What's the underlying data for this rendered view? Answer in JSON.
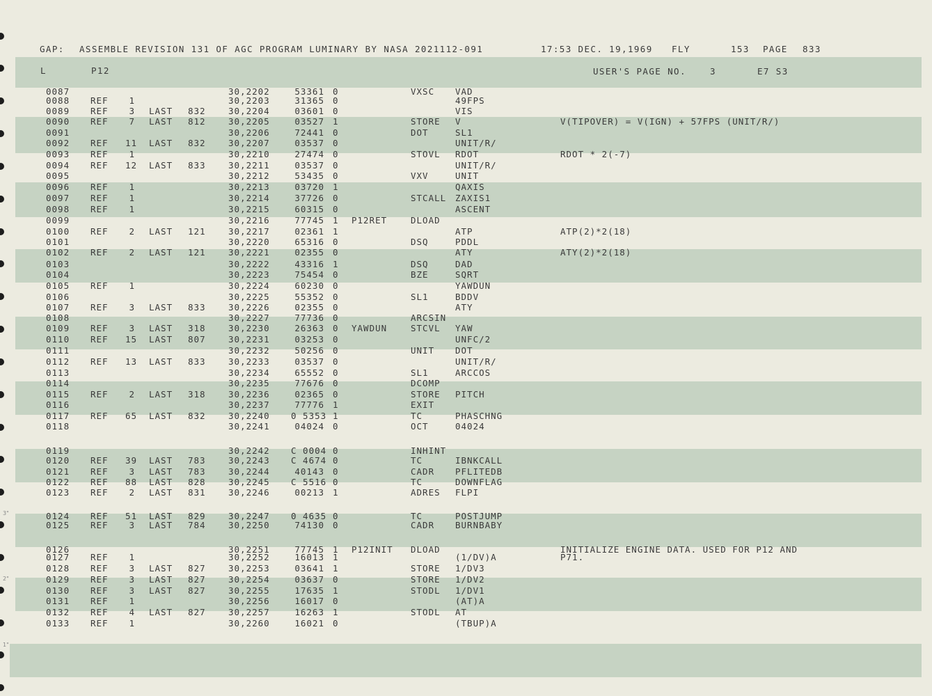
{
  "header": {
    "line1": {
      "gap": "GAP:",
      "title": "ASSEMBLE REVISION 131 OF AGC PROGRAM LUMINARY BY NASA 2021112-091",
      "time": "17:53 DEC. 19,1969",
      "fly": "FLY",
      "num": "153",
      "page_label": "PAGE",
      "page": "833"
    },
    "line2": {
      "l": "L",
      "prog": "P12",
      "users_page": "USER'S PAGE NO.",
      "users_page_num": "3",
      "e7s3": "E7 S3"
    }
  },
  "rows": [
    {
      "n": "0087",
      "ref": "",
      "rn": "",
      "last": "",
      "lp": "",
      "addr": "30,2202",
      "code": "53361",
      "par": "0",
      "label": "",
      "op": "VXSC",
      "operand": "VAD",
      "comment": ""
    },
    {
      "n": "0088",
      "ref": "REF",
      "rn": "1",
      "last": "",
      "lp": "",
      "addr": "30,2203",
      "code": "31365",
      "par": "0",
      "label": "",
      "op": "",
      "operand": "49FPS",
      "comment": ""
    },
    {
      "n": "0089",
      "ref": "REF",
      "rn": "3",
      "last": "LAST",
      "lp": "832",
      "addr": "30,2204",
      "code": "03601",
      "par": "0",
      "label": "",
      "op": "",
      "operand": "VIS",
      "comment": ""
    },
    {
      "n": "0090",
      "ref": "REF",
      "rn": "7",
      "last": "LAST",
      "lp": "812",
      "addr": "30,2205",
      "code": "03527",
      "par": "1",
      "label": "",
      "op": "STORE",
      "operand": "V",
      "comment": "V(TIPOVER) = V(IGN) + 57FPS (UNIT/R/)"
    },
    {
      "n": "0091",
      "ref": "",
      "rn": "",
      "last": "",
      "lp": "",
      "addr": "30,2206",
      "code": "72441",
      "par": "0",
      "label": "",
      "op": "DOT",
      "operand": "SL1",
      "comment": ""
    },
    {
      "n": "0092",
      "ref": "REF",
      "rn": "11",
      "last": "LAST",
      "lp": "832",
      "addr": "30,2207",
      "code": "03537",
      "par": "0",
      "label": "",
      "op": "",
      "operand": "UNIT/R/",
      "comment": ""
    },
    {
      "n": "0093",
      "ref": "REF",
      "rn": "1",
      "last": "",
      "lp": "",
      "addr": "30,2210",
      "code": "27474",
      "par": "0",
      "label": "",
      "op": "STOVL",
      "operand": "RDOT",
      "comment": "RDOT * 2(-7)"
    },
    {
      "n": "0094",
      "ref": "REF",
      "rn": "12",
      "last": "LAST",
      "lp": "833",
      "addr": "30,2211",
      "code": "03537",
      "par": "0",
      "label": "",
      "op": "",
      "operand": "UNIT/R/",
      "comment": ""
    },
    {
      "n": "0095",
      "ref": "",
      "rn": "",
      "last": "",
      "lp": "",
      "addr": "30,2212",
      "code": "53435",
      "par": "0",
      "label": "",
      "op": "VXV",
      "operand": "UNIT",
      "comment": ""
    },
    {
      "n": "0096",
      "ref": "REF",
      "rn": "1",
      "last": "",
      "lp": "",
      "addr": "30,2213",
      "code": "03720",
      "par": "1",
      "label": "",
      "op": "",
      "operand": "QAXIS",
      "comment": ""
    },
    {
      "n": "0097",
      "ref": "REF",
      "rn": "1",
      "last": "",
      "lp": "",
      "addr": "30,2214",
      "code": "37726",
      "par": "0",
      "label": "",
      "op": "STCALL",
      "operand": "ZAXIS1",
      "comment": ""
    },
    {
      "n": "0098",
      "ref": "REF",
      "rn": "1",
      "last": "",
      "lp": "",
      "addr": "30,2215",
      "code": "60315",
      "par": "0",
      "label": "",
      "op": "",
      "operand": "ASCENT",
      "comment": ""
    },
    {
      "n": "0099",
      "ref": "",
      "rn": "",
      "last": "",
      "lp": "",
      "addr": "30,2216",
      "code": "77745",
      "par": "1",
      "label": "P12RET",
      "op": "DLOAD",
      "operand": "",
      "comment": ""
    },
    {
      "n": "0100",
      "ref": "REF",
      "rn": "2",
      "last": "LAST",
      "lp": "121",
      "addr": "30,2217",
      "code": "02361",
      "par": "1",
      "label": "",
      "op": "",
      "operand": "ATP",
      "comment": "ATP(2)*2(18)"
    },
    {
      "n": "0101",
      "ref": "",
      "rn": "",
      "last": "",
      "lp": "",
      "addr": "30,2220",
      "code": "65316",
      "par": "0",
      "label": "",
      "op": "DSQ",
      "operand": "PDDL",
      "comment": ""
    },
    {
      "n": "0102",
      "ref": "REF",
      "rn": "2",
      "last": "LAST",
      "lp": "121",
      "addr": "30,2221",
      "code": "02355",
      "par": "0",
      "label": "",
      "op": "",
      "operand": "ATY",
      "comment": "ATY(2)*2(18)"
    },
    {
      "n": "0103",
      "ref": "",
      "rn": "",
      "last": "",
      "lp": "",
      "addr": "30,2222",
      "code": "43316",
      "par": "1",
      "label": "",
      "op": "DSQ",
      "operand": "DAD",
      "comment": ""
    },
    {
      "n": "0104",
      "ref": "",
      "rn": "",
      "last": "",
      "lp": "",
      "addr": "30,2223",
      "code": "75454",
      "par": "0",
      "label": "",
      "op": "BZE",
      "operand": "SQRT",
      "comment": ""
    },
    {
      "n": "0105",
      "ref": "REF",
      "rn": "1",
      "last": "",
      "lp": "",
      "addr": "30,2224",
      "code": "60230",
      "par": "0",
      "label": "",
      "op": "",
      "operand": "YAWDUN",
      "comment": ""
    },
    {
      "n": "0106",
      "ref": "",
      "rn": "",
      "last": "",
      "lp": "",
      "addr": "30,2225",
      "code": "55352",
      "par": "0",
      "label": "",
      "op": "SL1",
      "operand": "BDDV",
      "comment": ""
    },
    {
      "n": "0107",
      "ref": "REF",
      "rn": "3",
      "last": "LAST",
      "lp": "833",
      "addr": "30,2226",
      "code": "02355",
      "par": "0",
      "label": "",
      "op": "",
      "operand": "ATY",
      "comment": ""
    },
    {
      "n": "0108",
      "ref": "",
      "rn": "",
      "last": "",
      "lp": "",
      "addr": "30,2227",
      "code": "77736",
      "par": "0",
      "label": "",
      "op": "ARCSIN",
      "operand": "",
      "comment": ""
    },
    {
      "n": "0109",
      "ref": "REF",
      "rn": "3",
      "last": "LAST",
      "lp": "318",
      "addr": "30,2230",
      "code": "26363",
      "par": "0",
      "label": "YAWDUN",
      "op": "STCVL",
      "operand": "YAW",
      "comment": ""
    },
    {
      "n": "0110",
      "ref": "REF",
      "rn": "15",
      "last": "LAST",
      "lp": "807",
      "addr": "30,2231",
      "code": "03253",
      "par": "0",
      "label": "",
      "op": "",
      "operand": "UNFC/2",
      "comment": ""
    },
    {
      "n": "0111",
      "ref": "",
      "rn": "",
      "last": "",
      "lp": "",
      "addr": "30,2232",
      "code": "50256",
      "par": "0",
      "label": "",
      "op": "UNIT",
      "operand": "DOT",
      "comment": ""
    },
    {
      "n": "0112",
      "ref": "REF",
      "rn": "13",
      "last": "LAST",
      "lp": "833",
      "addr": "30,2233",
      "code": "03537",
      "par": "0",
      "label": "",
      "op": "",
      "operand": "UNIT/R/",
      "comment": ""
    },
    {
      "n": "0113",
      "ref": "",
      "rn": "",
      "last": "",
      "lp": "",
      "addr": "30,2234",
      "code": "65552",
      "par": "0",
      "label": "",
      "op": "SL1",
      "operand": "ARCCOS",
      "comment": ""
    },
    {
      "n": "0114",
      "ref": "",
      "rn": "",
      "last": "",
      "lp": "",
      "addr": "30,2235",
      "code": "77676",
      "par": "0",
      "label": "",
      "op": "DCOMP",
      "operand": "",
      "comment": ""
    },
    {
      "n": "0115",
      "ref": "REF",
      "rn": "2",
      "last": "LAST",
      "lp": "318",
      "addr": "30,2236",
      "code": "02365",
      "par": "0",
      "label": "",
      "op": "STORE",
      "operand": "PITCH",
      "comment": ""
    },
    {
      "n": "0116",
      "ref": "",
      "rn": "",
      "last": "",
      "lp": "",
      "addr": "30,2237",
      "code": "77776",
      "par": "1",
      "label": "",
      "op": "EXIT",
      "operand": "",
      "comment": ""
    },
    {
      "n": "0117",
      "ref": "REF",
      "rn": "65",
      "last": "LAST",
      "lp": "832",
      "addr": "30,2240",
      "code": "0 5353",
      "par": "1",
      "label": "",
      "op": "TC",
      "operand": "PHASCHNG",
      "comment": ""
    },
    {
      "n": "0118",
      "ref": "",
      "rn": "",
      "last": "",
      "lp": "",
      "addr": "30,2241",
      "code": "04024",
      "par": "0",
      "label": "",
      "op": "OCT",
      "operand": "04024",
      "comment": ""
    },
    {
      "n": "0119",
      "ref": "",
      "rn": "",
      "last": "",
      "lp": "",
      "addr": "30,2242",
      "code": "C 0004",
      "par": "0",
      "label": "",
      "op": "INHINT",
      "operand": "",
      "comment": ""
    },
    {
      "n": "0120",
      "ref": "REF",
      "rn": "39",
      "last": "LAST",
      "lp": "783",
      "addr": "30,2243",
      "code": "C 4674",
      "par": "0",
      "label": "",
      "op": "TC",
      "operand": "IBNKCALL",
      "comment": ""
    },
    {
      "n": "0121",
      "ref": "REF",
      "rn": "3",
      "last": "LAST",
      "lp": "783",
      "addr": "30,2244",
      "code": "40143",
      "par": "0",
      "label": "",
      "op": "CADR",
      "operand": "PFLITEDB",
      "comment": ""
    },
    {
      "n": "0122",
      "ref": "REF",
      "rn": "88",
      "last": "LAST",
      "lp": "828",
      "addr": "30,2245",
      "code": "C 5516",
      "par": "0",
      "label": "",
      "op": "TC",
      "operand": "DOWNFLAG",
      "comment": ""
    },
    {
      "n": "0123",
      "ref": "REF",
      "rn": "2",
      "last": "LAST",
      "lp": "831",
      "addr": "30,2246",
      "code": "00213",
      "par": "1",
      "label": "",
      "op": "ADRES",
      "operand": "FLPI",
      "comment": ""
    },
    {
      "n": "0124",
      "ref": "REF",
      "rn": "51",
      "last": "LAST",
      "lp": "829",
      "addr": "30,2247",
      "code": "0 4635",
      "par": "0",
      "label": "",
      "op": "TC",
      "operand": "POSTJUMP",
      "comment": ""
    },
    {
      "n": "0125",
      "ref": "REF",
      "rn": "3",
      "last": "LAST",
      "lp": "784",
      "addr": "30,2250",
      "code": "74130",
      "par": "0",
      "label": "",
      "op": "CADR",
      "operand": "BURNBABY",
      "comment": ""
    },
    {
      "n": "0126",
      "ref": "",
      "rn": "",
      "last": "",
      "lp": "",
      "addr": "30,2251",
      "code": "77745",
      "par": "1",
      "label": "P12INIT",
      "op": "DLOAD",
      "operand": "",
      "comment": "INITIALIZE ENGINE DATA. USED FOR P12 AND"
    },
    {
      "n": "0127",
      "ref": "REF",
      "rn": "1",
      "last": "",
      "lp": "",
      "addr": "30,2252",
      "code": "16013",
      "par": "1",
      "label": "",
      "op": "",
      "operand": "(1/DV)A",
      "comment": "P71."
    },
    {
      "n": "0128",
      "ref": "REF",
      "rn": "3",
      "last": "LAST",
      "lp": "827",
      "addr": "30,2253",
      "code": "03641",
      "par": "1",
      "label": "",
      "op": "STORE",
      "operand": "1/DV3",
      "comment": ""
    },
    {
      "n": "0129",
      "ref": "REF",
      "rn": "3",
      "last": "LAST",
      "lp": "827",
      "addr": "30,2254",
      "code": "03637",
      "par": "0",
      "label": "",
      "op": "STORE",
      "operand": "1/DV2",
      "comment": ""
    },
    {
      "n": "0130",
      "ref": "REF",
      "rn": "3",
      "last": "LAST",
      "lp": "827",
      "addr": "30,2255",
      "code": "17635",
      "par": "1",
      "label": "",
      "op": "STODL",
      "operand": "1/DV1",
      "comment": ""
    },
    {
      "n": "0131",
      "ref": "REF",
      "rn": "1",
      "last": "",
      "lp": "",
      "addr": "30,2256",
      "code": "16017",
      "par": "0",
      "label": "",
      "op": "",
      "operand": "(AT)A",
      "comment": ""
    },
    {
      "n": "0132",
      "ref": "REF",
      "rn": "4",
      "last": "LAST",
      "lp": "827",
      "addr": "30,2257",
      "code": "16263",
      "par": "1",
      "label": "",
      "op": "STODL",
      "operand": "AT",
      "comment": ""
    },
    {
      "n": "0133",
      "ref": "REF",
      "rn": "1",
      "last": "",
      "lp": "",
      "addr": "30,2260",
      "code": "16021",
      "par": "0",
      "label": "",
      "op": "",
      "operand": "(TBUP)A",
      "comment": ""
    }
  ],
  "margin_marks": [
    "3\"",
    "2\"",
    "1\""
  ]
}
